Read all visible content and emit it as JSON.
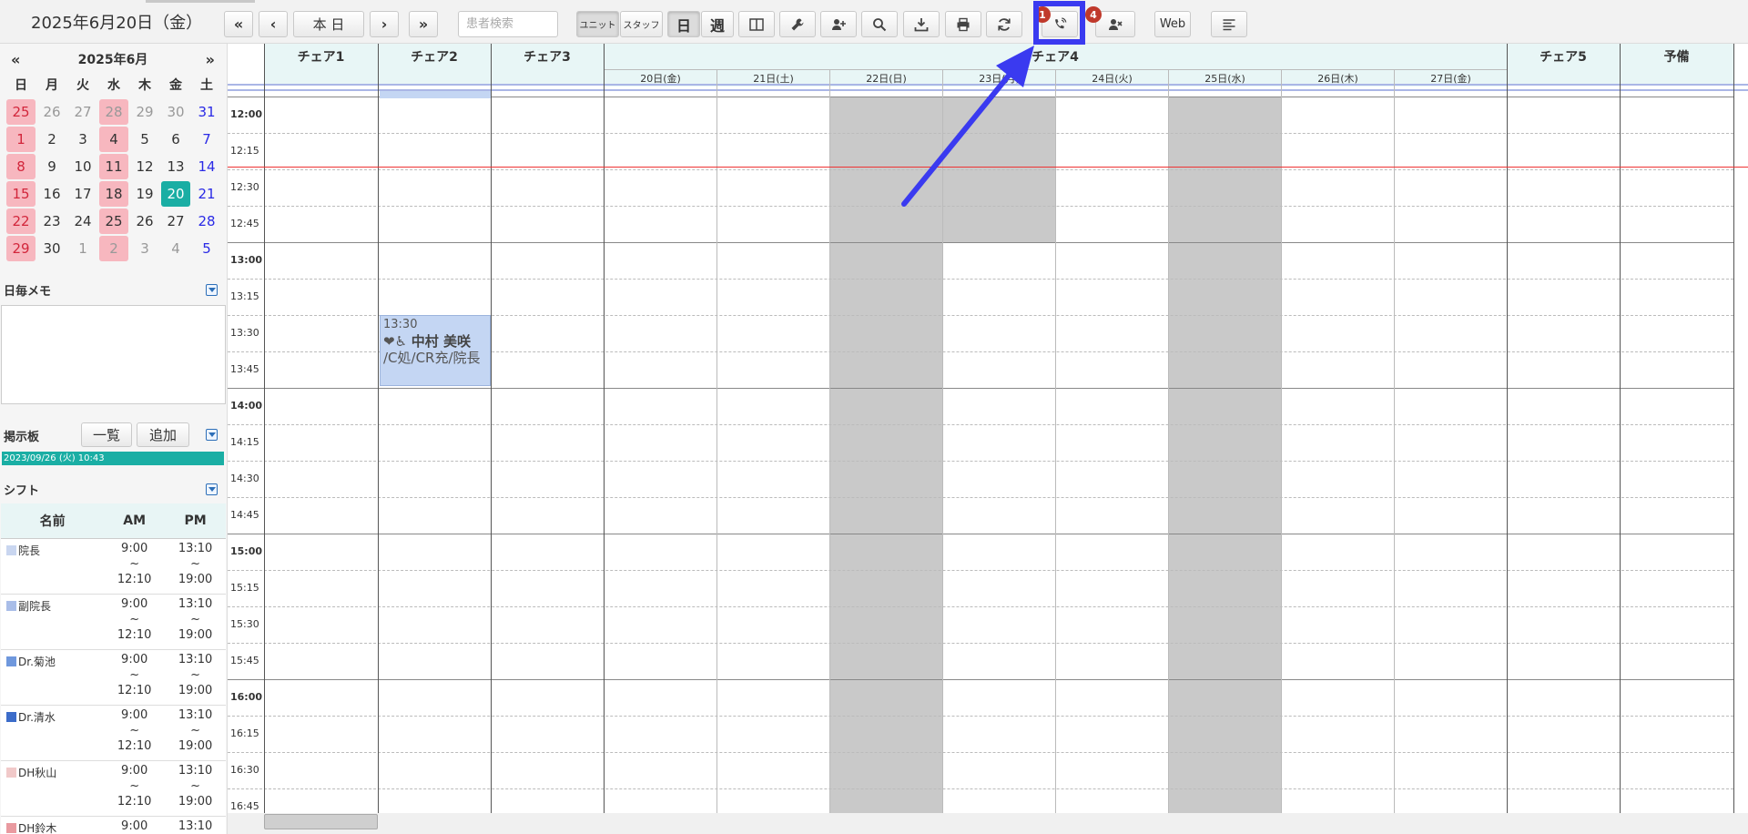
{
  "toolbar": {
    "date_title": "2025年6月20日（金）",
    "prev_fast": "«",
    "prev": "‹",
    "today": "本 日",
    "next": "›",
    "next_fast": "»",
    "search_placeholder": "患者検索",
    "unit_label": "ユニット",
    "staff_label": "スタッフ",
    "day_label": "日",
    "week_label": "週",
    "call_badge": "1",
    "cancel_badge": "4",
    "web_label": "Web"
  },
  "mini_calendar": {
    "prev": "«",
    "next": "»",
    "month_title": "2025年6月",
    "weekdays": [
      "日",
      "月",
      "火",
      "水",
      "木",
      "金",
      "土"
    ],
    "days": [
      {
        "d": "25",
        "cls": "sun hol"
      },
      {
        "d": "26",
        "cls": "other"
      },
      {
        "d": "27",
        "cls": "other"
      },
      {
        "d": "28",
        "cls": "other hol"
      },
      {
        "d": "29",
        "cls": "other"
      },
      {
        "d": "30",
        "cls": "other"
      },
      {
        "d": "31",
        "cls": "sat"
      },
      {
        "d": "1",
        "cls": "sun hol"
      },
      {
        "d": "2",
        "cls": ""
      },
      {
        "d": "3",
        "cls": ""
      },
      {
        "d": "4",
        "cls": "hol"
      },
      {
        "d": "5",
        "cls": ""
      },
      {
        "d": "6",
        "cls": ""
      },
      {
        "d": "7",
        "cls": "sat"
      },
      {
        "d": "8",
        "cls": "sun hol"
      },
      {
        "d": "9",
        "cls": ""
      },
      {
        "d": "10",
        "cls": ""
      },
      {
        "d": "11",
        "cls": "hol"
      },
      {
        "d": "12",
        "cls": ""
      },
      {
        "d": "13",
        "cls": ""
      },
      {
        "d": "14",
        "cls": "sat"
      },
      {
        "d": "15",
        "cls": "sun hol"
      },
      {
        "d": "16",
        "cls": ""
      },
      {
        "d": "17",
        "cls": ""
      },
      {
        "d": "18",
        "cls": "hol"
      },
      {
        "d": "19",
        "cls": ""
      },
      {
        "d": "20",
        "cls": "today"
      },
      {
        "d": "21",
        "cls": "sat"
      },
      {
        "d": "22",
        "cls": "sun hol"
      },
      {
        "d": "23",
        "cls": ""
      },
      {
        "d": "24",
        "cls": ""
      },
      {
        "d": "25",
        "cls": "hol"
      },
      {
        "d": "26",
        "cls": ""
      },
      {
        "d": "27",
        "cls": ""
      },
      {
        "d": "28",
        "cls": "sat"
      },
      {
        "d": "29",
        "cls": "sun hol"
      },
      {
        "d": "30",
        "cls": ""
      },
      {
        "d": "1",
        "cls": "other"
      },
      {
        "d": "2",
        "cls": "other hol"
      },
      {
        "d": "3",
        "cls": "other"
      },
      {
        "d": "4",
        "cls": "other"
      },
      {
        "d": "5",
        "cls": "sat"
      }
    ]
  },
  "memo": {
    "title": "日毎メモ"
  },
  "board": {
    "title": "掲示板",
    "list_button": "一覧",
    "add_button": "追加",
    "latest": "2023/09/26 (火) 10:43"
  },
  "shift": {
    "title": "シフト",
    "col_name": "名前",
    "col_am": "AM",
    "col_pm": "PM",
    "tilde": "~",
    "rows": [
      {
        "name": "院長",
        "color": "#c9d6f0",
        "am_from": "9:00",
        "am_to": "12:10",
        "pm_from": "13:10",
        "pm_to": "19:00"
      },
      {
        "name": "副院長",
        "color": "#a9bde8",
        "am_from": "9:00",
        "am_to": "12:10",
        "pm_from": "13:10",
        "pm_to": "19:00"
      },
      {
        "name": "Dr.菊池",
        "color": "#6f98dd",
        "am_from": "9:00",
        "am_to": "12:10",
        "pm_from": "13:10",
        "pm_to": "19:00"
      },
      {
        "name": "Dr.清水",
        "color": "#3c6cc9",
        "am_from": "9:00",
        "am_to": "12:10",
        "pm_from": "13:10",
        "pm_to": "19:00"
      },
      {
        "name": "DH秋山",
        "color": "#f1c9c9",
        "am_from": "9:00",
        "am_to": "12:10",
        "pm_from": "13:10",
        "pm_to": "19:00"
      },
      {
        "name": "DH鈴木",
        "color": "#e99aa0",
        "am_from": "9:00",
        "am_to": "",
        "pm_from": "13:10",
        "pm_to": ""
      }
    ]
  },
  "schedule": {
    "chairs": [
      "チェア1",
      "チェア2",
      "チェア3",
      "チェア4",
      "チェア5",
      "予備"
    ],
    "chair4_days": [
      "20日(金)",
      "21日(土)",
      "22日(日)",
      "23日(月)",
      "24日(火)",
      "25日(水)",
      "26日(木)",
      "27日(金)"
    ],
    "times": [
      "12:00",
      "12:15",
      "12:30",
      "12:45",
      "13:00",
      "13:15",
      "13:30",
      "13:45",
      "14:00",
      "14:15",
      "14:30",
      "14:45",
      "15:00",
      "15:15",
      "15:30",
      "15:45",
      "16:00",
      "16:15",
      "16:30",
      "16:45"
    ],
    "appointment": {
      "time": "13:30",
      "icons": "❤♿",
      "patient": "中村 美咲",
      "detail": "/C処/CR充/院長"
    }
  }
}
